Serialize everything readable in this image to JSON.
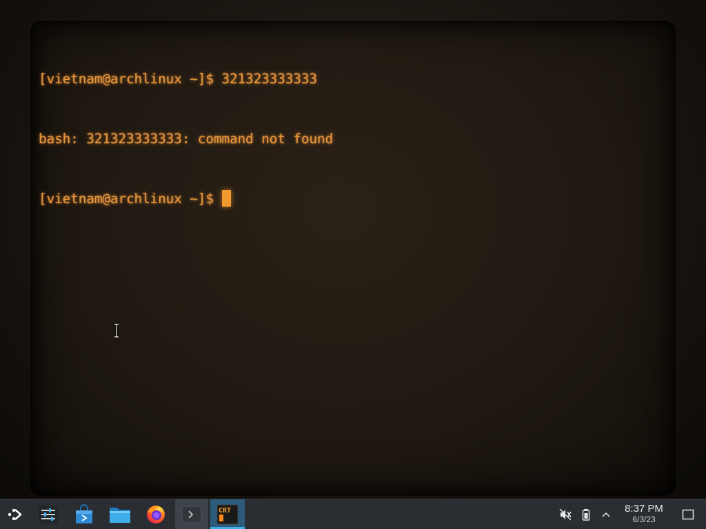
{
  "terminal": {
    "lines": [
      "[vietnam@archlinux ~]$ 321323333333",
      "bash: 321323333333: command not found",
      "[vietnam@archlinux ~]$"
    ],
    "text_color": "#e7963a"
  },
  "taskbar": {
    "items": [
      {
        "name": "application-launcher",
        "icon": "app-launcher-icon",
        "active": false
      },
      {
        "name": "system-settings",
        "icon": "settings-sliders-icon",
        "active": false
      },
      {
        "name": "discover-store",
        "icon": "store-bag-icon",
        "active": false
      },
      {
        "name": "file-manager",
        "icon": "folder-icon",
        "active": false
      },
      {
        "name": "firefox",
        "icon": "firefox-icon",
        "active": false
      },
      {
        "name": "konsole",
        "icon": "terminal-icon",
        "active": true
      },
      {
        "name": "cool-retro-term",
        "icon": "crt-icon",
        "active": true,
        "label": "CRT"
      }
    ],
    "accent": "#3daee9"
  },
  "tray": {
    "icons": [
      "volume-muted-icon",
      "battery-icon",
      "chevron-up-icon"
    ],
    "time": "8:37 PM",
    "date": "6/3/23",
    "show_desktop_icon": "show-desktop-icon"
  }
}
